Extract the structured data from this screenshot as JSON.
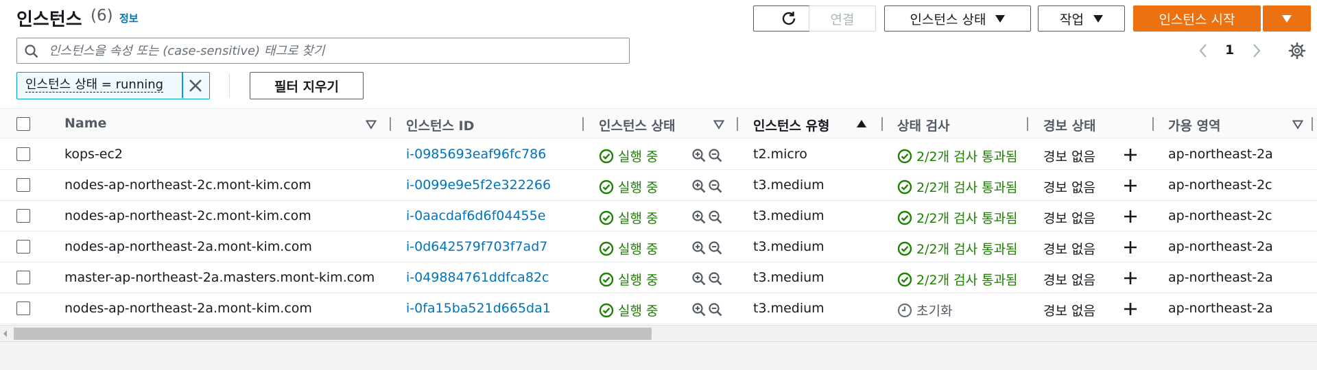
{
  "header": {
    "title": "인스턴스",
    "count": "(6)",
    "info_link": "정보"
  },
  "toolbar": {
    "connect_label": "연결",
    "instance_state_label": "인스턴스 상태",
    "actions_label": "작업",
    "launch_label": "인스턴스 시작"
  },
  "search": {
    "placeholder": "인스턴스을 속성 또는 (case-sensitive) 태그로 찾기",
    "value": ""
  },
  "pagination": {
    "current_page": "1"
  },
  "filter": {
    "token_label": "인스턴스 상태 = running",
    "clear_label": "필터 지우기"
  },
  "columns": {
    "name": "Name",
    "instance_id": "인스턴스 ID",
    "instance_state": "인스턴스 상태",
    "instance_type": "인스턴스 유형",
    "status_check": "상태 검사",
    "alarm_status": "경보 상태",
    "availability_zone": "가용 영역"
  },
  "rows": [
    {
      "name": "kops-ec2",
      "instance_id": "i-0985693eaf96fc786",
      "state": "실행 중",
      "type": "t2.micro",
      "check": "2/2개 검사 통과됨",
      "alarm": "경보 없음",
      "az": "ap-northeast-2a"
    },
    {
      "name": "nodes-ap-northeast-2c.mont-kim.com",
      "instance_id": "i-0099e9e5f2e322266",
      "state": "실행 중",
      "type": "t3.medium",
      "check": "2/2개 검사 통과됨",
      "alarm": "경보 없음",
      "az": "ap-northeast-2c"
    },
    {
      "name": "nodes-ap-northeast-2c.mont-kim.com",
      "instance_id": "i-0aacdaf6d6f04455e",
      "state": "실행 중",
      "type": "t3.medium",
      "check": "2/2개 검사 통과됨",
      "alarm": "경보 없음",
      "az": "ap-northeast-2c"
    },
    {
      "name": "nodes-ap-northeast-2a.mont-kim.com",
      "instance_id": "i-0d642579f703f7ad7",
      "state": "실행 중",
      "type": "t3.medium",
      "check": "2/2개 검사 통과됨",
      "alarm": "경보 없음",
      "az": "ap-northeast-2a"
    },
    {
      "name": "master-ap-northeast-2a.masters.mont-kim.com",
      "instance_id": "i-049884761ddfca82c",
      "state": "실행 중",
      "type": "t3.medium",
      "check": "2/2개 검사 통과됨",
      "alarm": "경보 없음",
      "az": "ap-northeast-2a"
    },
    {
      "name": "nodes-ap-northeast-2a.mont-kim.com",
      "instance_id": "i-0fa15ba521d665da1",
      "state": "실행 중",
      "type": "t3.medium",
      "check": "초기화",
      "alarm": "경보 없음",
      "az": "ap-northeast-2a"
    }
  ],
  "colors": {
    "primary_orange": "#ec7211",
    "link_blue": "#0073bb",
    "success_green": "#1d8102",
    "filter_token_border": "#00a1c9"
  }
}
